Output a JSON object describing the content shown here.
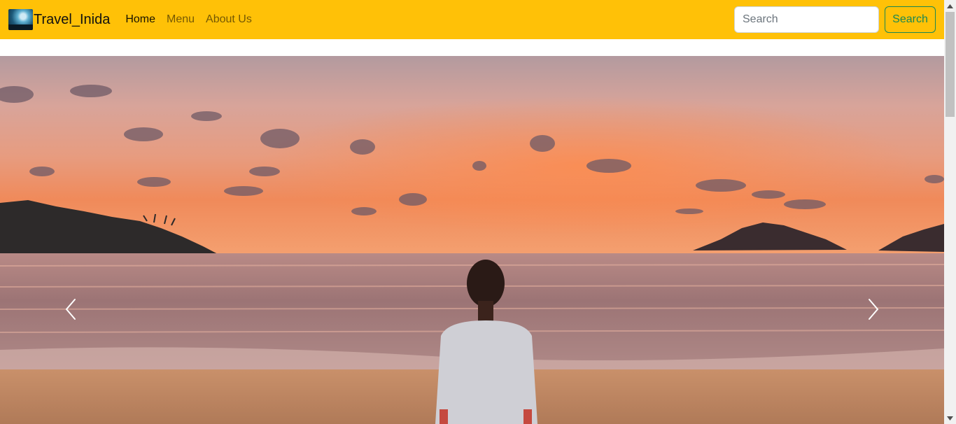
{
  "navbar": {
    "brand": "Travel_Inida",
    "links": [
      {
        "label": "Home",
        "active": true
      },
      {
        "label": "Menu",
        "active": false
      },
      {
        "label": "About Us",
        "active": false
      }
    ],
    "search": {
      "placeholder": "Search",
      "value": "",
      "button_label": "Search"
    }
  },
  "colors": {
    "navbar_bg": "#ffc107",
    "search_button": "#198754"
  },
  "carousel": {
    "image": "sunset-beach-photo",
    "prev_icon": "chevron-left-icon",
    "next_icon": "chevron-right-icon"
  }
}
